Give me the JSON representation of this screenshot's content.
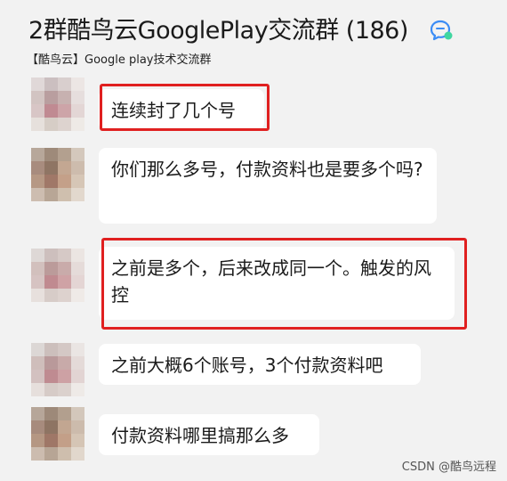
{
  "header": {
    "title": "2群酷鸟云GooglePlay交流群 (186)",
    "subtitle": "【酷鸟云】Google play技术交流群",
    "chat_icon": "chat-bubble-icon"
  },
  "messages": [
    {
      "text": "连续封了几个号"
    },
    {
      "text": "你们那么多号，付款资料也是要多个吗?"
    },
    {
      "text": "之前是多个，后来改成同一个。触发的风控"
    },
    {
      "text": "之前大概6个账号，3个付款资料吧"
    },
    {
      "text": "付款资料哪里搞那么多"
    }
  ],
  "watermark": "CSDN @酷鸟远程",
  "colors": {
    "background": "#f2f2f2",
    "bubble": "#ffffff",
    "highlight": "#e02020",
    "icon_blue": "#3b8cf5",
    "icon_green": "#3fd6a0"
  }
}
